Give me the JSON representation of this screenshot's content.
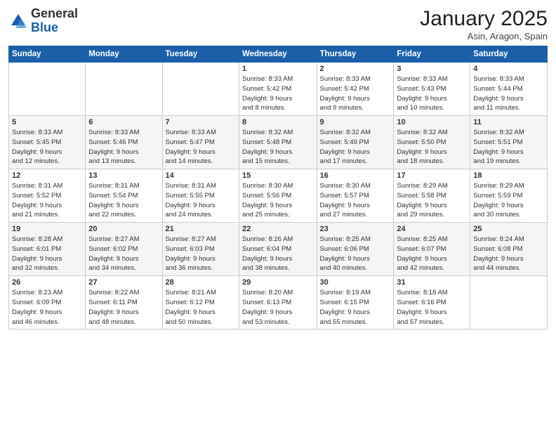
{
  "header": {
    "logo_general": "General",
    "logo_blue": "Blue",
    "title": "January 2025",
    "subtitle": "Asin, Aragon, Spain"
  },
  "weekdays": [
    "Sunday",
    "Monday",
    "Tuesday",
    "Wednesday",
    "Thursday",
    "Friday",
    "Saturday"
  ],
  "weeks": [
    [
      {
        "day": "",
        "info": ""
      },
      {
        "day": "",
        "info": ""
      },
      {
        "day": "",
        "info": ""
      },
      {
        "day": "1",
        "info": "Sunrise: 8:33 AM\nSunset: 5:42 PM\nDaylight: 9 hours\nand 8 minutes."
      },
      {
        "day": "2",
        "info": "Sunrise: 8:33 AM\nSunset: 5:42 PM\nDaylight: 9 hours\nand 9 minutes."
      },
      {
        "day": "3",
        "info": "Sunrise: 8:33 AM\nSunset: 5:43 PM\nDaylight: 9 hours\nand 10 minutes."
      },
      {
        "day": "4",
        "info": "Sunrise: 8:33 AM\nSunset: 5:44 PM\nDaylight: 9 hours\nand 11 minutes."
      }
    ],
    [
      {
        "day": "5",
        "info": "Sunrise: 8:33 AM\nSunset: 5:45 PM\nDaylight: 9 hours\nand 12 minutes."
      },
      {
        "day": "6",
        "info": "Sunrise: 8:33 AM\nSunset: 5:46 PM\nDaylight: 9 hours\nand 13 minutes."
      },
      {
        "day": "7",
        "info": "Sunrise: 8:33 AM\nSunset: 5:47 PM\nDaylight: 9 hours\nand 14 minutes."
      },
      {
        "day": "8",
        "info": "Sunrise: 8:32 AM\nSunset: 5:48 PM\nDaylight: 9 hours\nand 15 minutes."
      },
      {
        "day": "9",
        "info": "Sunrise: 8:32 AM\nSunset: 5:49 PM\nDaylight: 9 hours\nand 17 minutes."
      },
      {
        "day": "10",
        "info": "Sunrise: 8:32 AM\nSunset: 5:50 PM\nDaylight: 9 hours\nand 18 minutes."
      },
      {
        "day": "11",
        "info": "Sunrise: 8:32 AM\nSunset: 5:51 PM\nDaylight: 9 hours\nand 19 minutes."
      }
    ],
    [
      {
        "day": "12",
        "info": "Sunrise: 8:31 AM\nSunset: 5:52 PM\nDaylight: 9 hours\nand 21 minutes."
      },
      {
        "day": "13",
        "info": "Sunrise: 8:31 AM\nSunset: 5:54 PM\nDaylight: 9 hours\nand 22 minutes."
      },
      {
        "day": "14",
        "info": "Sunrise: 8:31 AM\nSunset: 5:55 PM\nDaylight: 9 hours\nand 24 minutes."
      },
      {
        "day": "15",
        "info": "Sunrise: 8:30 AM\nSunset: 5:56 PM\nDaylight: 9 hours\nand 25 minutes."
      },
      {
        "day": "16",
        "info": "Sunrise: 8:30 AM\nSunset: 5:57 PM\nDaylight: 9 hours\nand 27 minutes."
      },
      {
        "day": "17",
        "info": "Sunrise: 8:29 AM\nSunset: 5:58 PM\nDaylight: 9 hours\nand 29 minutes."
      },
      {
        "day": "18",
        "info": "Sunrise: 8:29 AM\nSunset: 5:59 PM\nDaylight: 9 hours\nand 30 minutes."
      }
    ],
    [
      {
        "day": "19",
        "info": "Sunrise: 8:28 AM\nSunset: 6:01 PM\nDaylight: 9 hours\nand 32 minutes."
      },
      {
        "day": "20",
        "info": "Sunrise: 8:27 AM\nSunset: 6:02 PM\nDaylight: 9 hours\nand 34 minutes."
      },
      {
        "day": "21",
        "info": "Sunrise: 8:27 AM\nSunset: 6:03 PM\nDaylight: 9 hours\nand 36 minutes."
      },
      {
        "day": "22",
        "info": "Sunrise: 8:26 AM\nSunset: 6:04 PM\nDaylight: 9 hours\nand 38 minutes."
      },
      {
        "day": "23",
        "info": "Sunrise: 8:25 AM\nSunset: 6:06 PM\nDaylight: 9 hours\nand 40 minutes."
      },
      {
        "day": "24",
        "info": "Sunrise: 8:25 AM\nSunset: 6:07 PM\nDaylight: 9 hours\nand 42 minutes."
      },
      {
        "day": "25",
        "info": "Sunrise: 8:24 AM\nSunset: 6:08 PM\nDaylight: 9 hours\nand 44 minutes."
      }
    ],
    [
      {
        "day": "26",
        "info": "Sunrise: 8:23 AM\nSunset: 6:09 PM\nDaylight: 9 hours\nand 46 minutes."
      },
      {
        "day": "27",
        "info": "Sunrise: 8:22 AM\nSunset: 6:11 PM\nDaylight: 9 hours\nand 48 minutes."
      },
      {
        "day": "28",
        "info": "Sunrise: 8:21 AM\nSunset: 6:12 PM\nDaylight: 9 hours\nand 50 minutes."
      },
      {
        "day": "29",
        "info": "Sunrise: 8:20 AM\nSunset: 6:13 PM\nDaylight: 9 hours\nand 53 minutes."
      },
      {
        "day": "30",
        "info": "Sunrise: 8:19 AM\nSunset: 6:15 PM\nDaylight: 9 hours\nand 55 minutes."
      },
      {
        "day": "31",
        "info": "Sunrise: 8:18 AM\nSunset: 6:16 PM\nDaylight: 9 hours\nand 57 minutes."
      },
      {
        "day": "",
        "info": ""
      }
    ]
  ]
}
